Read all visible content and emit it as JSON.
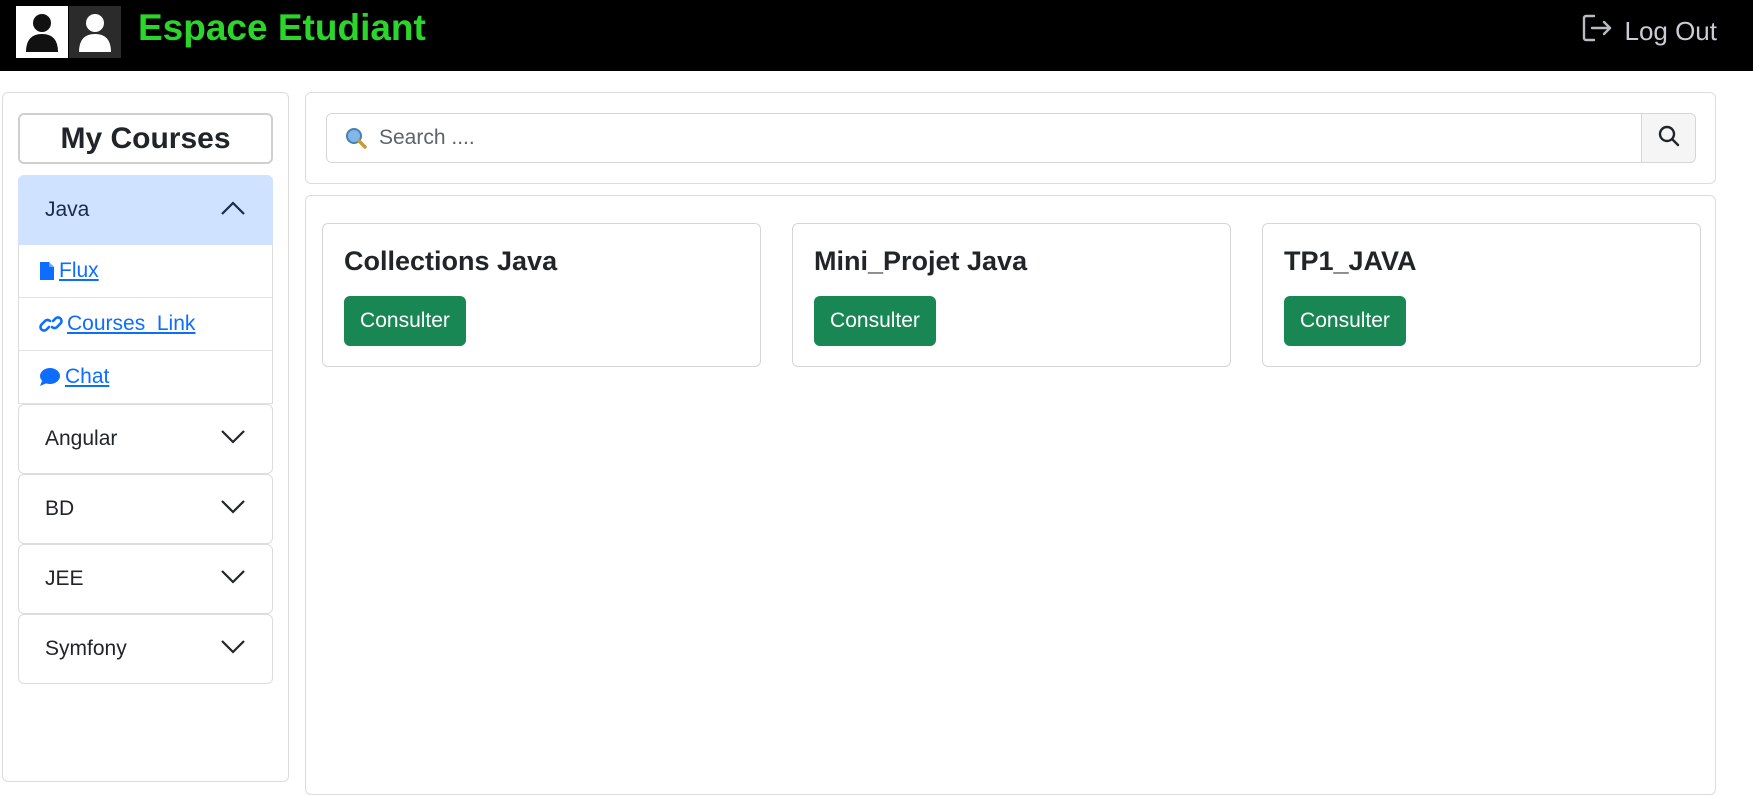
{
  "header": {
    "brand": "Espace Etudiant",
    "logout_label": "Log Out"
  },
  "sidebar": {
    "title": "My Courses",
    "courses": [
      {
        "name": "Java",
        "expanded": true,
        "links": [
          {
            "label": " Flux",
            "icon": "file-icon"
          },
          {
            "label": " Courses_Link",
            "icon": "link-icon"
          },
          {
            "label": " Chat",
            "icon": "chat-icon"
          }
        ]
      },
      {
        "name": "Angular",
        "expanded": false
      },
      {
        "name": "BD",
        "expanded": false
      },
      {
        "name": "JEE",
        "expanded": false
      },
      {
        "name": "Symfony",
        "expanded": false
      }
    ]
  },
  "search": {
    "placeholder": "Search ...."
  },
  "cards": [
    {
      "title": "Collections Java",
      "button": "Consulter"
    },
    {
      "title": "Mini_Projet Java",
      "button": "Consulter"
    },
    {
      "title": "TP1_JAVA",
      "button": "Consulter"
    }
  ],
  "colors": {
    "brand": "#2bd52b",
    "accent_button": "#198754",
    "link": "#0d6efd",
    "active_header": "#cfe2ff"
  }
}
